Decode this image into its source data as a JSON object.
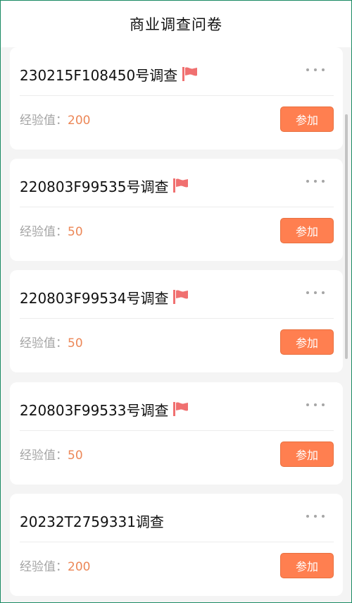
{
  "header": {
    "title": "商业调查问卷"
  },
  "labels": {
    "exp_label": "经验值：",
    "join_label": "参加"
  },
  "colors": {
    "accent": "#ff7f50",
    "flag": "#f07070",
    "exp_value": "#ec8757"
  },
  "surveys": [
    {
      "title": "230215F108450号调查",
      "flagged": true,
      "exp": "200"
    },
    {
      "title": "220803F99535号调查",
      "flagged": true,
      "exp": "50"
    },
    {
      "title": "220803F99534号调查",
      "flagged": true,
      "exp": "50"
    },
    {
      "title": "220803F99533号调查",
      "flagged": true,
      "exp": "50"
    },
    {
      "title": "20232T2759331调查",
      "flagged": false,
      "exp": "200"
    }
  ]
}
